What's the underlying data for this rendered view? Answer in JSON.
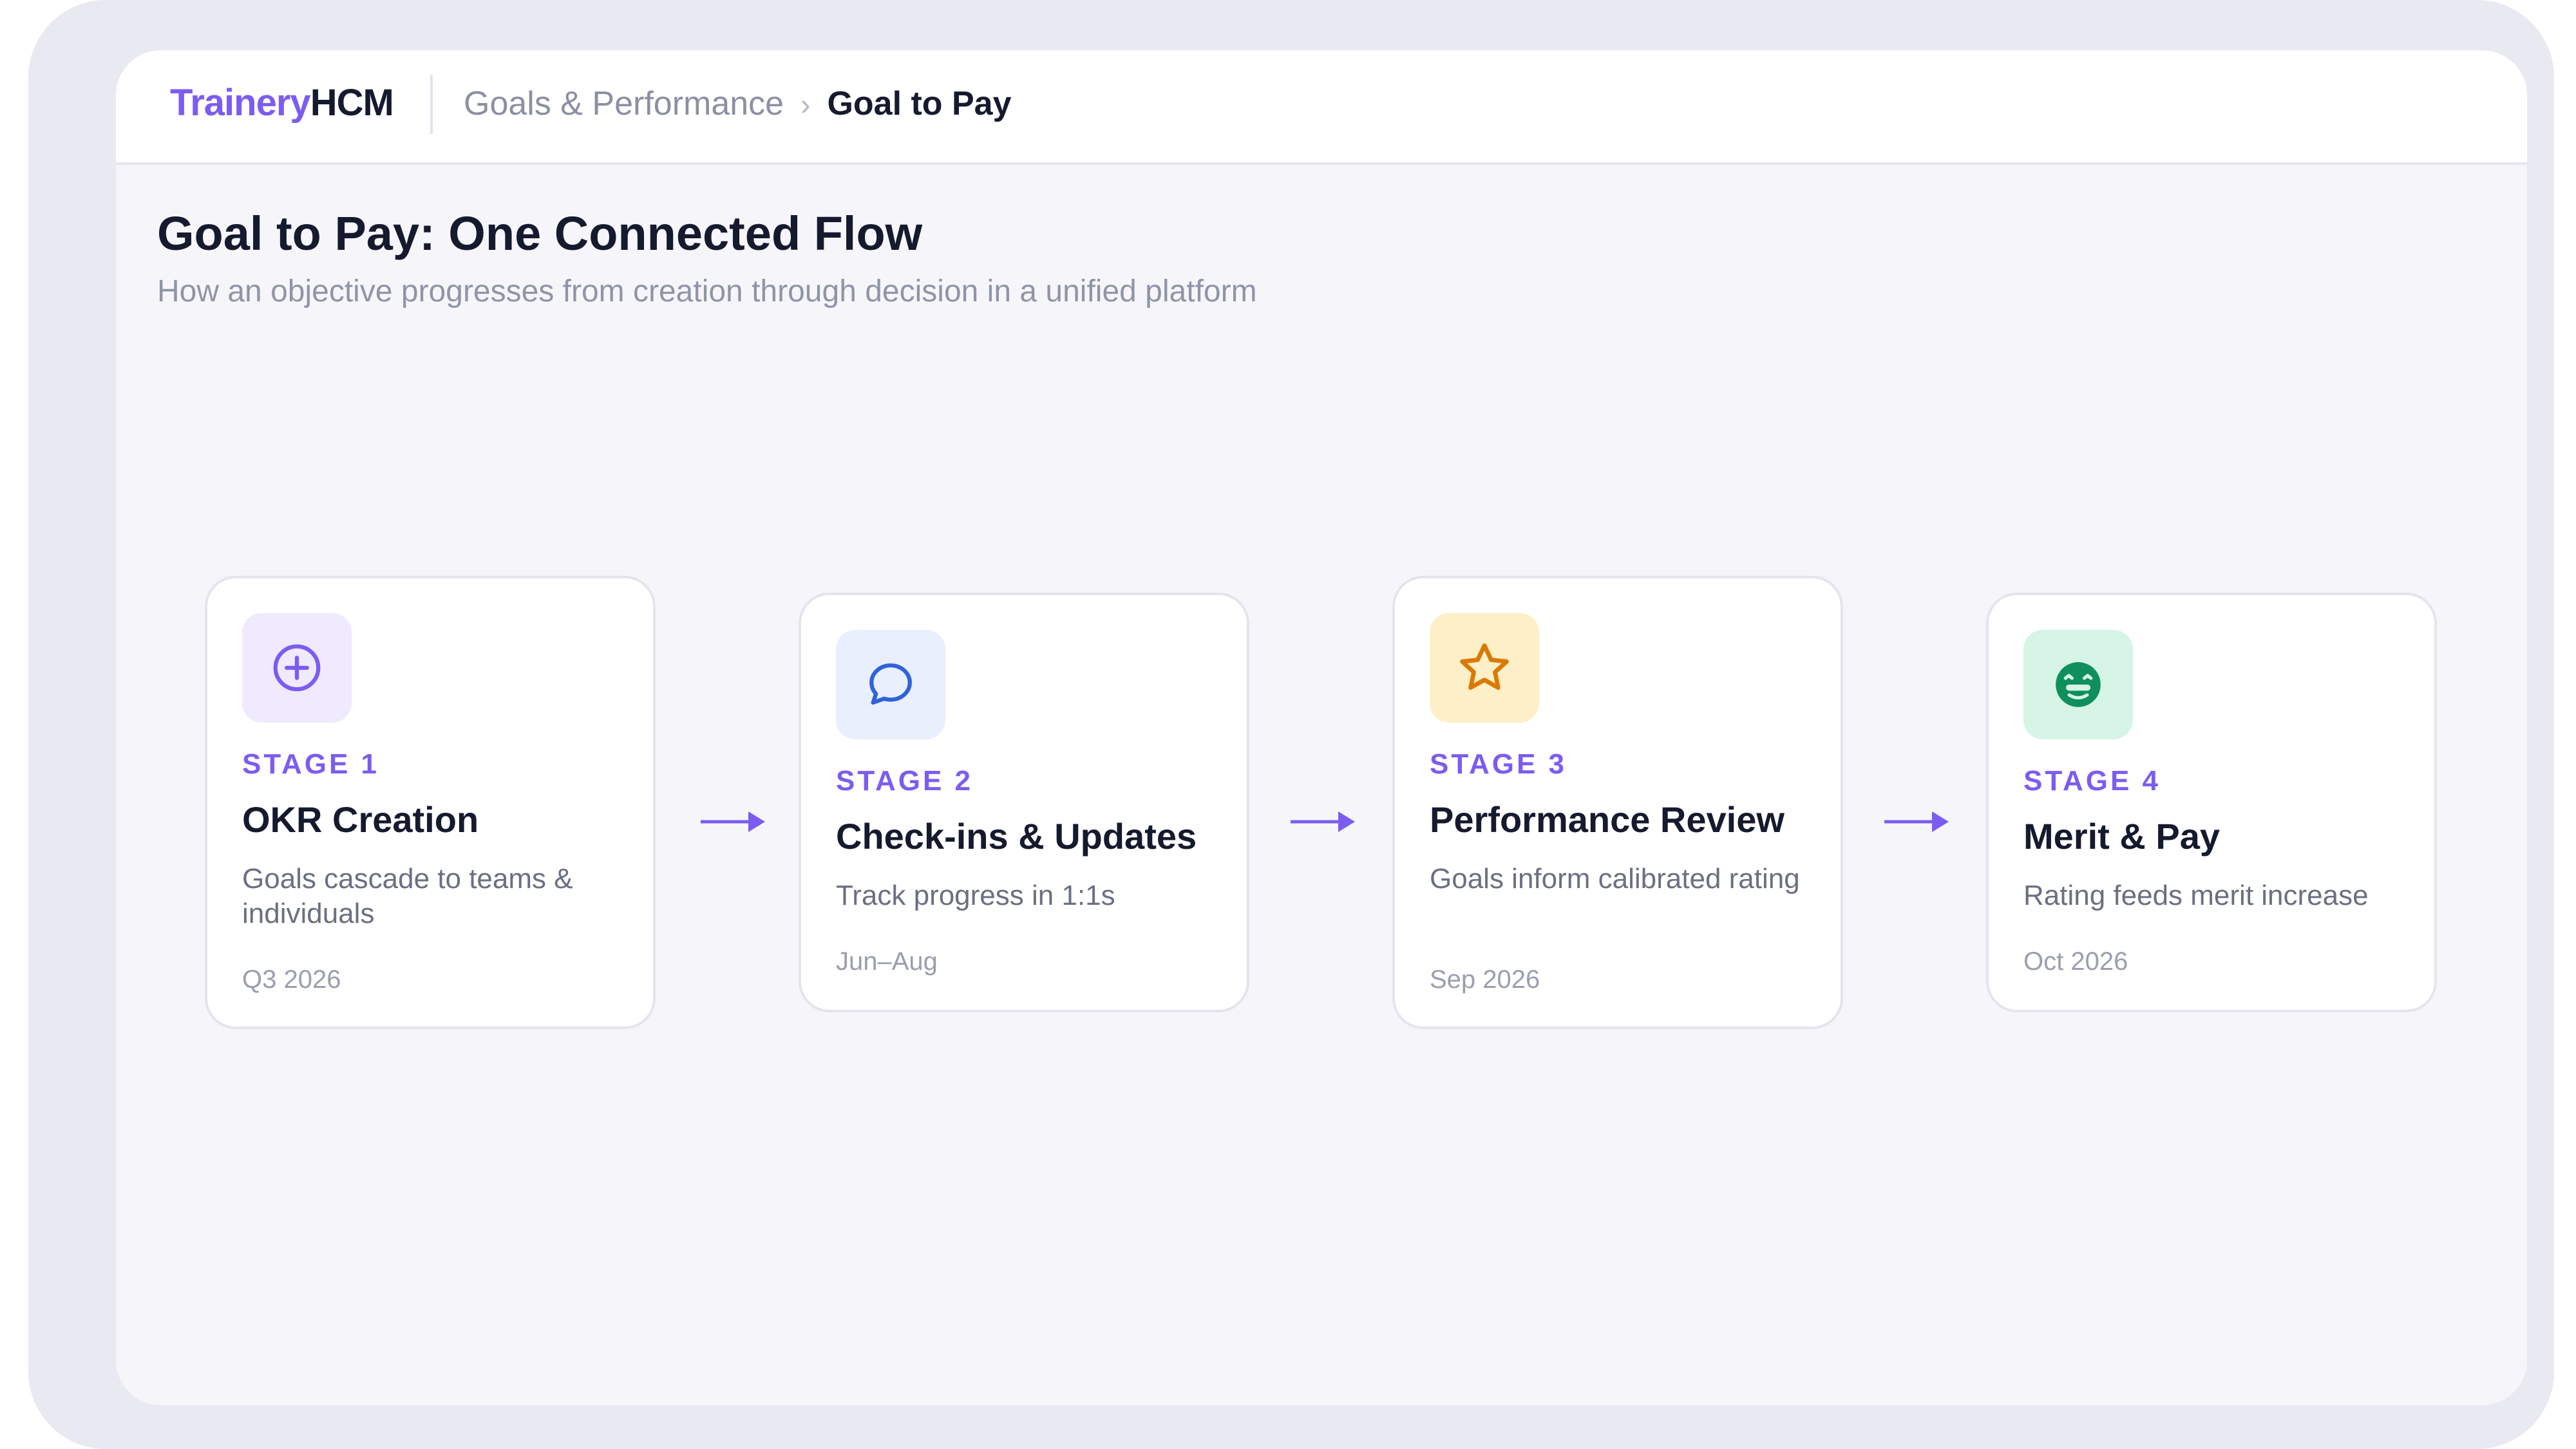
{
  "header": {
    "logo_primary": "Trainery",
    "logo_secondary": "HCM",
    "breadcrumb_parent": "Goals & Performance",
    "breadcrumb_separator": "›",
    "breadcrumb_current": "Goal to Pay"
  },
  "page": {
    "title": "Goal to Pay: One Connected Flow",
    "subtitle": "How an objective progresses from creation through decision in a unified platform"
  },
  "stages": [
    {
      "label": "STAGE 1",
      "title": "OKR Creation",
      "description": "Goals cascade to teams & individuals",
      "date": "Q3 2026",
      "icon": "plus-circle-icon",
      "icon_bg": "#efeafe",
      "icon_color": "#7c5cf0"
    },
    {
      "label": "STAGE 2",
      "title": "Check-ins & Updates",
      "description": "Track progress in 1:1s",
      "date": "Jun–Aug",
      "icon": "chat-bubble-icon",
      "icon_bg": "#e9effd",
      "icon_color": "#2f63d9"
    },
    {
      "label": "STAGE 3",
      "title": "Performance Review",
      "description": "Goals inform calibrated rating",
      "date": "Sep 2026",
      "icon": "star-icon",
      "icon_bg": "#fdefc7",
      "icon_color": "#d97a06"
    },
    {
      "label": "STAGE 4",
      "title": "Merit & Pay",
      "description": "Rating feeds merit increase",
      "date": "Oct 2026",
      "icon": "money-face-icon",
      "icon_bg": "#d6f5e6",
      "icon_color": "#0e8f5c"
    }
  ],
  "colors": {
    "accent": "#7c5cf0",
    "arrow": "#7c5cf0"
  }
}
